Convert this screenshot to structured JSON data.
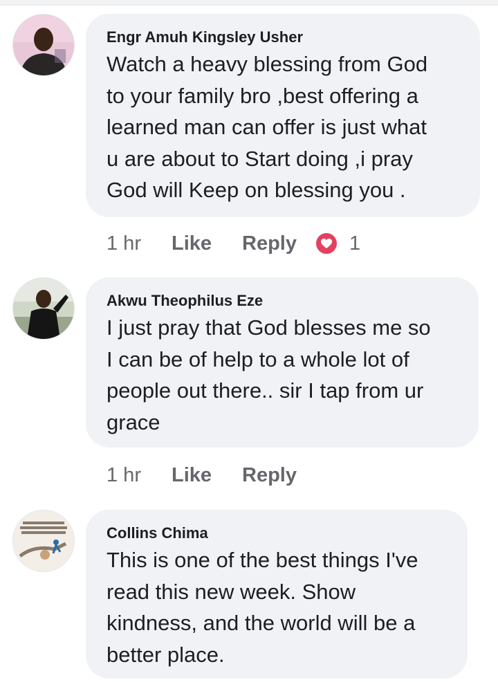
{
  "comments": [
    {
      "author": "Engr Amuh Kingsley Usher",
      "text": "Watch a heavy blessing from God\nto your family bro ,best offering a\nlearned man can offer is just what\nu are about to Start doing ,i pray\nGod will Keep on blessing you .",
      "time": "1 hr",
      "like": "Like",
      "reply": "Reply",
      "reaction_count": "1",
      "reaction_icon": "love-reaction-icon",
      "reaction_color": "#e4405f"
    },
    {
      "author": "Akwu Theophilus Eze",
      "text": "I just pray that God blesses me so\nI can be of help to a whole lot of\npeople out there.. sir I tap from ur\ngrace",
      "time": "1 hr",
      "like": "Like",
      "reply": "Reply"
    },
    {
      "author": "Collins Chima",
      "text": "This is one of the best things I've\nread this new week. Show\nkindness, and the world will be a\nbetter place.",
      "avatar_text": "LEADER DOESN'T ... -RATION. A TRUE LEA... BRINGS PEOPLE TOGETHER."
    }
  ],
  "colors": {
    "bubble": "#f0f2f5",
    "text": "#1c1e21",
    "secondary": "#65676b"
  }
}
